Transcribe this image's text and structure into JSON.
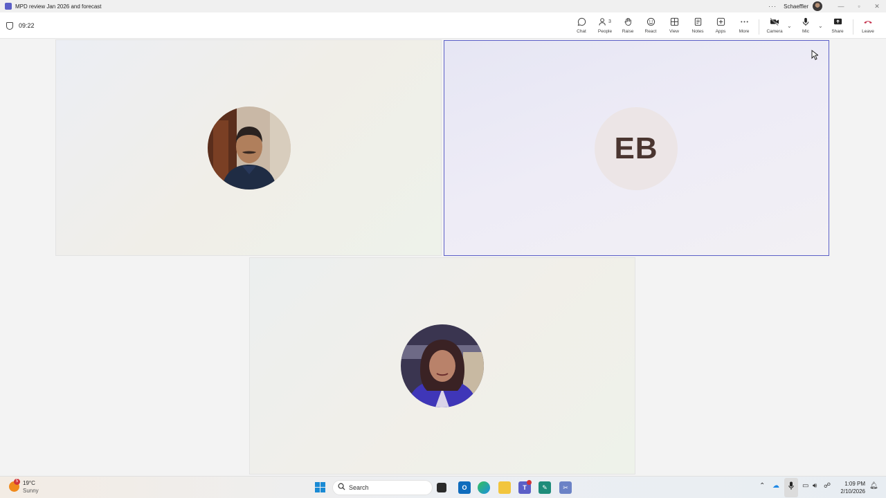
{
  "window": {
    "title": "MPD review Jan 2026 and forecast",
    "more": "···",
    "user_name": "Schaeffler",
    "minimize": "—",
    "restore": "▫",
    "close": "✕"
  },
  "meeting": {
    "timer": "09:22",
    "toolbar": {
      "chat": "Chat",
      "people": "People",
      "people_count": "3",
      "raise": "Raise",
      "react": "React",
      "view": "View",
      "notes": "Notes",
      "apps": "Apps",
      "more": "More",
      "camera": "Camera",
      "mic": "Mic",
      "share": "Share",
      "leave": "Leave"
    }
  },
  "participants": [
    {
      "type": "photo"
    },
    {
      "type": "initials",
      "initials": "EB"
    },
    {
      "type": "photo"
    }
  ],
  "taskbar": {
    "weather": {
      "badge": "5",
      "temp": "19°C",
      "condition": "Sunny"
    },
    "search_label": "Search",
    "time": "1:09 PM",
    "date": "2/10/2026"
  },
  "colors": {
    "accent": "#5b5fc7",
    "leave": "#c4314b"
  }
}
